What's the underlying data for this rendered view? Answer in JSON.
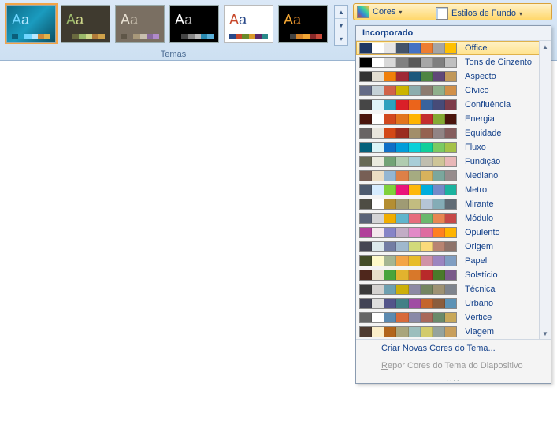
{
  "ribbon": {
    "group_label": "Temas",
    "cores_label": "Cores",
    "estilos_label": "Estilos de Fundo",
    "themes": [
      {
        "bg": "linear-gradient(135deg,#0d6a86 0%,#1a9bbf 50%,#0b4f63 100%)",
        "aa_a": "#6fd6ff",
        "aa_b": "#b7e8ff",
        "sw": [
          "#0b5e7a",
          "#1a9bbf",
          "#6fd6ff",
          "#b7e8ff",
          "#d08a3a",
          "#e0b24a"
        ],
        "selected": true
      },
      {
        "bg": "#3f3a2f",
        "aa_a": "#9ab86a",
        "aa_b": "#cfd88a",
        "sw": [
          "#3f3a2f",
          "#6a6a3f",
          "#9ab86a",
          "#cfd88a",
          "#b07a3a",
          "#d0a24a"
        ]
      },
      {
        "bg": "#7a6f62",
        "aa_a": "#e6ded0",
        "aa_b": "#c8bfae",
        "sw": [
          "#5f5648",
          "#7a6f62",
          "#a8987a",
          "#c8bfae",
          "#8a6aa0",
          "#b08aca"
        ]
      },
      {
        "bg": "#000000",
        "aa_a": "#ffffff",
        "aa_b": "#b0b0b0",
        "sw": [
          "#000000",
          "#444444",
          "#888888",
          "#bbbbbb",
          "#2a8ab0",
          "#5ab0d8"
        ]
      },
      {
        "bg": "#ffffff",
        "aa_a": "#c8482a",
        "aa_b": "#2a4a8a",
        "sw": [
          "#2a4a8a",
          "#c8482a",
          "#6a8a2a",
          "#d89a2a",
          "#5a2a6a",
          "#2a8a8a"
        ],
        "border": "#bbb"
      },
      {
        "bg": "#000000",
        "aa_a": "#f2a634",
        "aa_b": "#d8852a",
        "sw": [
          "#000000",
          "#444444",
          "#d8852a",
          "#f2a634",
          "#8a2a2a",
          "#c84a3a"
        ]
      }
    ]
  },
  "dropdown": {
    "header": "Incorporado",
    "create_cmd": "Criar Novas Cores do Tema...",
    "reset_cmd": "Repor Cores do Tema do Diapositivo",
    "schemes": [
      {
        "name": "Office",
        "colors": [
          "#1f3864",
          "#ffffff",
          "#e7e6e6",
          "#44546a",
          "#4472c4",
          "#ed7d31",
          "#a5a5a5",
          "#ffc000"
        ]
      },
      {
        "name": "Tons de Cinzento",
        "colors": [
          "#000000",
          "#ffffff",
          "#d9d9d9",
          "#808080",
          "#595959",
          "#a6a6a6",
          "#7f7f7f",
          "#bfbfbf"
        ]
      },
      {
        "name": "Aspecto",
        "colors": [
          "#323232",
          "#e3ded1",
          "#f07f09",
          "#9f2936",
          "#1b587c",
          "#4e8542",
          "#604878",
          "#c19859"
        ]
      },
      {
        "name": "Cívico",
        "colors": [
          "#646b86",
          "#c5d1d7",
          "#d16349",
          "#ccb400",
          "#8cadae",
          "#8c7b70",
          "#8fb08c",
          "#d19049"
        ]
      },
      {
        "name": "Confluência",
        "colors": [
          "#464646",
          "#def5fa",
          "#2da2bf",
          "#da1f28",
          "#eb641b",
          "#39639d",
          "#474b78",
          "#7d3c4a"
        ]
      },
      {
        "name": "Energia",
        "colors": [
          "#4a140c",
          "#ffffff",
          "#d2481e",
          "#e2751d",
          "#ffb400",
          "#c32d2e",
          "#84aa33",
          "#4a140c"
        ]
      },
      {
        "name": "Equidade",
        "colors": [
          "#696464",
          "#e9e5dc",
          "#d34817",
          "#9b2d1f",
          "#a28e6a",
          "#956251",
          "#918485",
          "#855d5d"
        ]
      },
      {
        "name": "Fluxo",
        "colors": [
          "#04617b",
          "#dbf5f9",
          "#0f6fc6",
          "#009dd9",
          "#0bd0d9",
          "#10cf9b",
          "#7cca62",
          "#a5c249"
        ]
      },
      {
        "name": "Fundição",
        "colors": [
          "#676a55",
          "#eaebde",
          "#72a376",
          "#b0ccb0",
          "#a8cdd7",
          "#c0beaf",
          "#cec597",
          "#e8b7b7"
        ]
      },
      {
        "name": "Mediano",
        "colors": [
          "#775f55",
          "#ebddc3",
          "#94b6d2",
          "#dd8047",
          "#a5ab81",
          "#d8b25c",
          "#7ba79d",
          "#968c8c"
        ]
      },
      {
        "name": "Metro",
        "colors": [
          "#4e5b6f",
          "#d6ecff",
          "#7fd13b",
          "#ea157a",
          "#feb80a",
          "#00addc",
          "#738ac8",
          "#1ab39f"
        ]
      },
      {
        "name": "Mirante",
        "colors": [
          "#4e4d44",
          "#ffffff",
          "#b48e32",
          "#9f9b74",
          "#c2bc80",
          "#b5c5d6",
          "#84acb6",
          "#606b74"
        ]
      },
      {
        "name": "Módulo",
        "colors": [
          "#5a6378",
          "#d4d4d6",
          "#f0ad00",
          "#60b5cc",
          "#e66c7d",
          "#6bb76d",
          "#e88651",
          "#c64847"
        ]
      },
      {
        "name": "Opulento",
        "colors": [
          "#b13f9a",
          "#f4e7ed",
          "#8784c7",
          "#c2adc5",
          "#e28ac7",
          "#de6ca0",
          "#ff8021",
          "#ffb400"
        ]
      },
      {
        "name": "Origem",
        "colors": [
          "#464653",
          "#dde9ec",
          "#727ca3",
          "#9fb8cd",
          "#d2da7a",
          "#fada7a",
          "#b88472",
          "#8e736a"
        ]
      },
      {
        "name": "Papel",
        "colors": [
          "#444d26",
          "#fefac9",
          "#a5b592",
          "#f3a447",
          "#e7bc29",
          "#d092a7",
          "#9c85c0",
          "#809ec2"
        ]
      },
      {
        "name": "Solstício",
        "colors": [
          "#4f271c",
          "#e7dec9",
          "#4aa43a",
          "#e2b32e",
          "#d8782a",
          "#b82a2a",
          "#4a7a2a",
          "#7a5a8a"
        ]
      },
      {
        "name": "Técnica",
        "colors": [
          "#3b3b3b",
          "#d4d2d0",
          "#6ea0b0",
          "#ccaf0a",
          "#8d89a4",
          "#748560",
          "#9e9273",
          "#7e848d"
        ]
      },
      {
        "name": "Urbano",
        "colors": [
          "#424456",
          "#dedede",
          "#53548a",
          "#438086",
          "#a04da3",
          "#c4652d",
          "#8b5d3d",
          "#5c92b5"
        ]
      },
      {
        "name": "Vértice",
        "colors": [
          "#666666",
          "#ffffff",
          "#5c8ab0",
          "#d86a3a",
          "#8a8aa8",
          "#a8685a",
          "#6a8a6a",
          "#c8a85a"
        ]
      },
      {
        "name": "Viagem",
        "colors": [
          "#4e3b30",
          "#fbeec9",
          "#b2651b",
          "#a9a57c",
          "#9cbebd",
          "#d2cb6c",
          "#95a39d",
          "#c89f5d"
        ]
      }
    ]
  }
}
